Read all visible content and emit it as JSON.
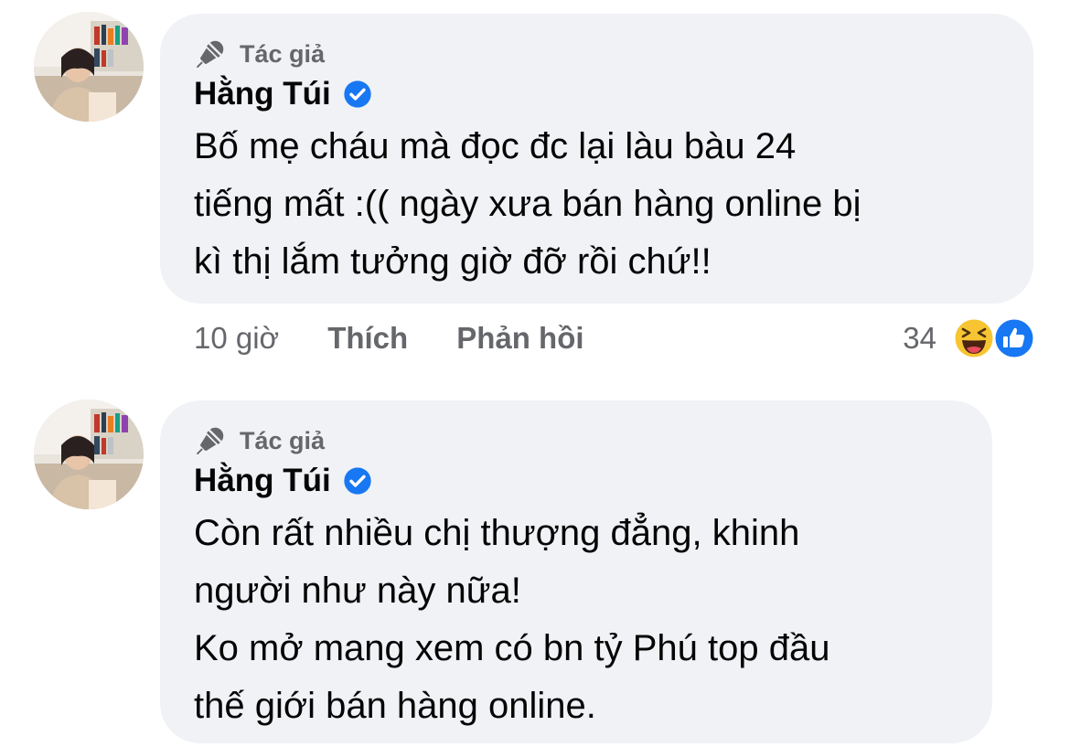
{
  "comments": [
    {
      "avatar_icon": "user-photo-avatar",
      "badge_icon": "microphone-icon",
      "badge_label": "Tác giả",
      "author_name": "Hằng Túi",
      "verified_icon": "verified-check-icon",
      "text": "Bố mẹ cháu mà đọc đc lại làu bàu 24\ntiếng mất :(( ngày xưa bán hàng online bị\nkì thị lắm tưởng giờ đỡ rồi chứ!!",
      "time": "10 giờ",
      "like_label": "Thích",
      "reply_label": "Phản hồi",
      "reaction_count": "34",
      "reaction_icons": [
        "haha-emoji-icon",
        "like-thumb-icon"
      ]
    },
    {
      "avatar_icon": "user-photo-avatar",
      "badge_icon": "microphone-icon",
      "badge_label": "Tác giả",
      "author_name": "Hằng Túi",
      "verified_icon": "verified-check-icon",
      "text": "Còn rất nhiều chị thượng đẳng, khinh\nngười như này nữa!\nKo mở mang xem có bn tỷ Phú top đầu\nthế giới bán hàng online."
    }
  ],
  "colors": {
    "bubble_bg": "#f0f2f5",
    "secondary_text": "#65676b",
    "primary_text": "#050505",
    "verified_blue": "#1877f2"
  }
}
